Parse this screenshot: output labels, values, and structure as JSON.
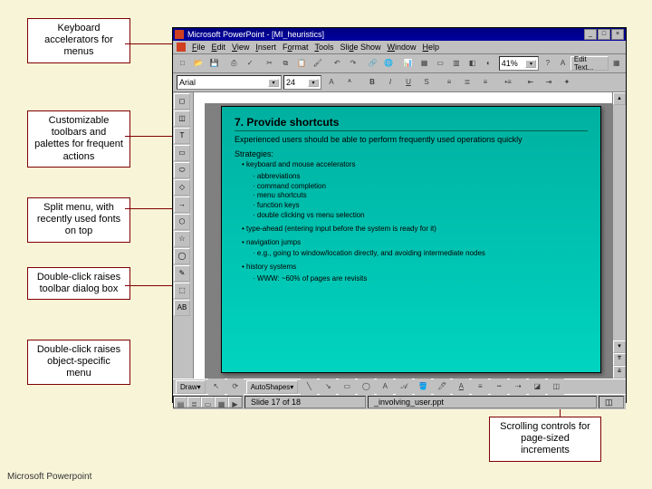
{
  "callouts": {
    "c1": "Keyboard accelerators for menus",
    "c2": "Customizable toolbars and palettes for frequent actions",
    "c3": "Split menu, with recently used fonts on top",
    "c4": "Double-click raises toolbar dialog box",
    "c5": "Double-click raises object-specific menu",
    "c6": "Scrolling controls for page-sized increments"
  },
  "footer": "Microsoft Powerpoint",
  "window": {
    "title": "Microsoft PowerPoint - [MI_heuristics]",
    "menus": [
      "File",
      "Edit",
      "View",
      "Insert",
      "Format",
      "Tools",
      "Slide Show",
      "Window",
      "Help"
    ],
    "font_name": "Arial",
    "font_size": "24",
    "zoom": "41%",
    "edit_text": "Edit Text...",
    "draw_label": "Draw",
    "autoshapes": "AutoShapes",
    "status_slide": "Slide 17 of 18",
    "status_file": "_involving_user.ppt"
  },
  "slide": {
    "title": "7. Provide shortcuts",
    "lead": "Experienced users should be able to perform frequently used operations quickly",
    "strategies_h": "Strategies:",
    "b1": "keyboard and mouse accelerators",
    "b1a": "abbreviations",
    "b1b": "command completion",
    "b1c": "menu shortcuts",
    "b1d": "function keys",
    "b1e": "double clicking vs menu selection",
    "b2": "type-ahead (entering input before the system is ready for it)",
    "b3": "navigation jumps",
    "b3a": "e.g., going to window/location directly, and avoiding intermediate nodes",
    "b4": "history systems",
    "b4a": "WWW: ~60% of pages are revisits"
  }
}
